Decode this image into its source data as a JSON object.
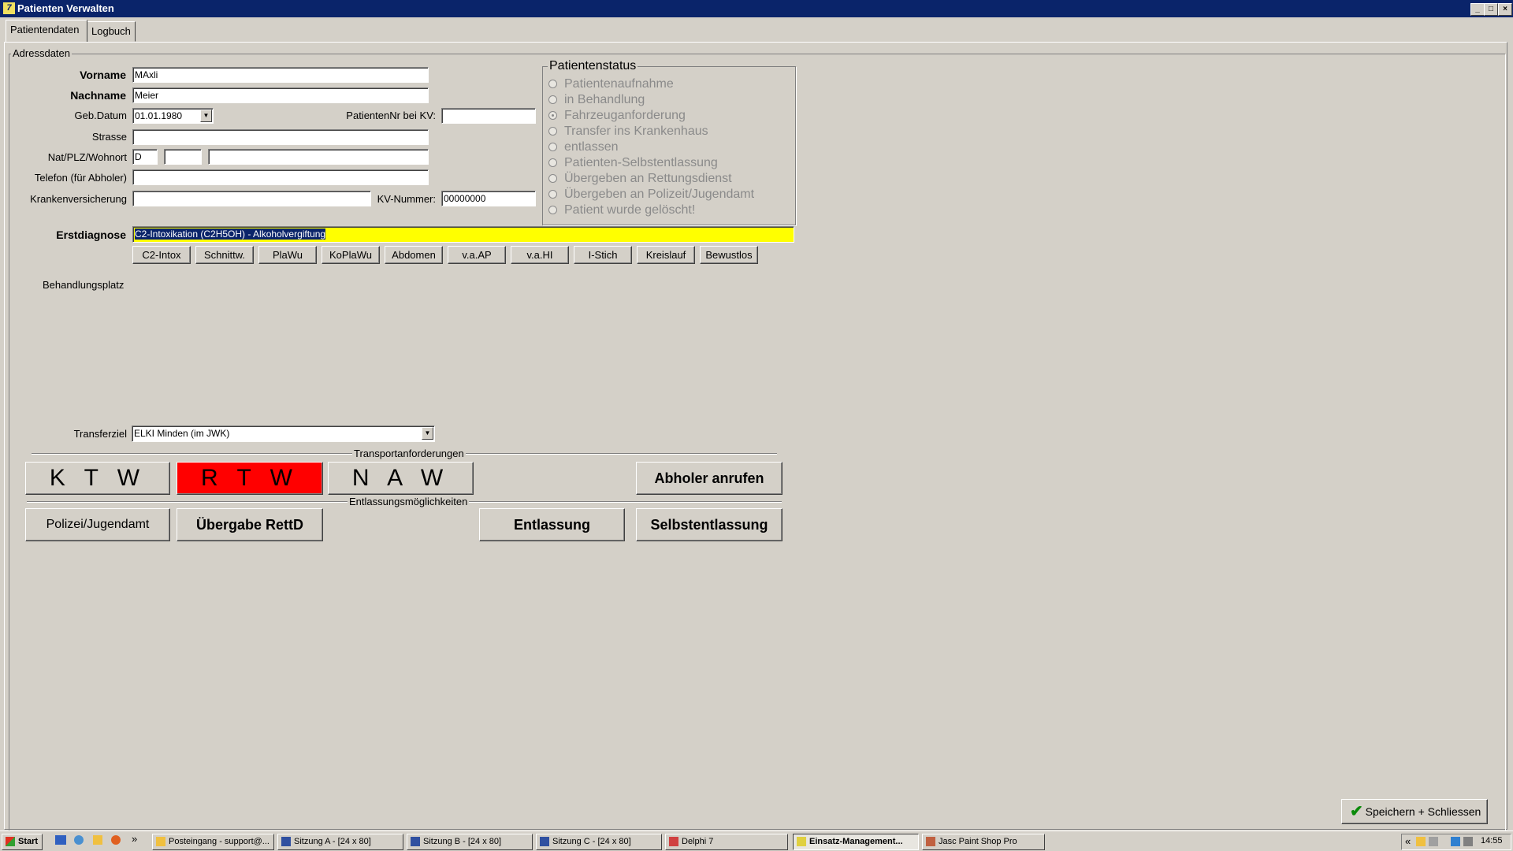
{
  "window": {
    "title": "Patienten Verwalten",
    "min": "_",
    "max": "□",
    "close": "×"
  },
  "tabs": [
    {
      "label": "Patientendaten"
    },
    {
      "label": "Logbuch"
    }
  ],
  "address": {
    "group_label": "Adressdaten",
    "vorname_label": "Vorname",
    "vorname": "MAxli",
    "nachname_label": "Nachname",
    "nachname": "Meier",
    "gebdatum_label": "Geb.Datum",
    "gebdatum": "01.01.1980",
    "patnr_label": "PatientenNr bei KV:",
    "patnr": "",
    "strasse_label": "Strasse",
    "strasse": "",
    "natplz_label": "Nat/PLZ/Wohnort",
    "nat": "D",
    "plz": "",
    "wohnort": "",
    "telefon_label": "Telefon (für Abholer)",
    "telefon": "",
    "kv_label": "Krankenversicherung",
    "kv": "",
    "kvnr_label": "KV-Nummer:",
    "kvnr": "00000000"
  },
  "status": {
    "group_label": "Patientenstatus",
    "options": [
      {
        "label": "Patientenaufnahme",
        "selected": false
      },
      {
        "label": "in Behandlung",
        "selected": false
      },
      {
        "label": "Fahrzeuganforderung",
        "selected": true
      },
      {
        "label": "Transfer ins Krankenhaus",
        "selected": false
      },
      {
        "label": "entlassen",
        "selected": false
      },
      {
        "label": "Patienten-Selbstentlassung",
        "selected": false
      },
      {
        "label": "Übergeben an Rettungsdienst",
        "selected": false
      },
      {
        "label": "Übergeben an Polizeit/Jugendamt",
        "selected": false
      },
      {
        "label": "Patient wurde gelöscht!",
        "selected": false
      }
    ]
  },
  "diagnose": {
    "label": "Erstdiagnose",
    "value": "C2-Intoxikation (C2H5OH) - Alkoholvergiftung",
    "highlight_color": "#ffff00",
    "quick_buttons": [
      "C2-Intox",
      "Schnittw.",
      "PlaWu",
      "KoPlaWu",
      "Abdomen",
      "v.a.AP",
      "v.a.HI",
      "I-Stich",
      "Kreislauf",
      "Bewustlos"
    ]
  },
  "behandlungsplatz_label": "Behandlungsplatz",
  "transfer": {
    "label": "Transferziel",
    "value": "ELKI Minden (im JWK)"
  },
  "transport": {
    "section_label": "Transportanforderungen",
    "ktw": "K T W",
    "rtw": "R T W",
    "naw": "N A W",
    "rtw_color": "#ff0000",
    "abholer": "Abholer anrufen"
  },
  "entlassung": {
    "section_label": "Entlassungsmöglichkeiten",
    "polizei": "Polizei/Jugendamt",
    "rettd": "Übergabe RettD",
    "entlassung": "Entlassung",
    "selbst": "Selbstentlassung"
  },
  "save_button": "Speichern + Schliessen",
  "taskbar": {
    "start": "Start",
    "items": [
      {
        "label": "Posteingang - support@..."
      },
      {
        "label": "Sitzung A - [24 x 80]"
      },
      {
        "label": "Sitzung B - [24 x 80]"
      },
      {
        "label": "Sitzung C - [24 x 80]"
      },
      {
        "label": "Delphi 7"
      },
      {
        "label": "Einsatz-Management..."
      },
      {
        "label": "Jasc Paint Shop Pro"
      }
    ],
    "chevron": "»",
    "tray_chevron": "«",
    "clock": "14:55"
  }
}
